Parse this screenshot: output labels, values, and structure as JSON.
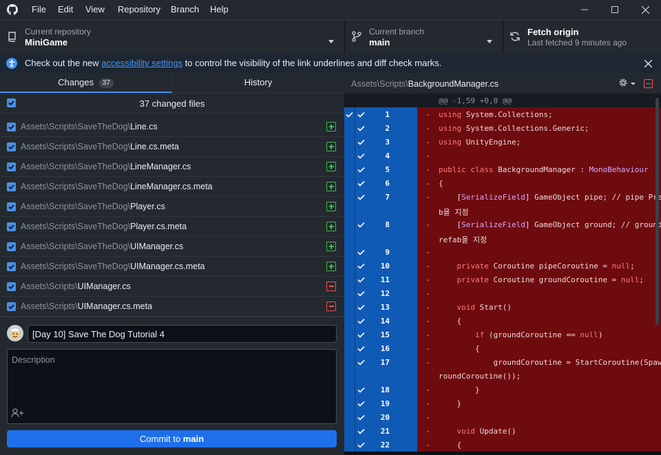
{
  "menu": [
    "File",
    "Edit",
    "View",
    "Repository",
    "Branch",
    "Help"
  ],
  "toolbar": {
    "repo_label": "Current repository",
    "repo_value": "MiniGame",
    "branch_label": "Current branch",
    "branch_value": "main",
    "fetch_label": "Fetch origin",
    "fetch_sub": "Last fetched 9 minutes ago"
  },
  "banner": {
    "before": "Check out the new ",
    "link": "accessibility settings",
    "after": " to control the visibility of the link underlines and diff check marks."
  },
  "tabs": {
    "changes": "Changes",
    "changes_count": "37",
    "history": "History"
  },
  "changed_files_label": "37 changed files",
  "files": [
    {
      "dir": "Assets\\Scripts\\SaveTheDog\\",
      "name": "Line.cs",
      "status": "added"
    },
    {
      "dir": "Assets\\Scripts\\SaveTheDog\\",
      "name": "Line.cs.meta",
      "status": "added"
    },
    {
      "dir": "Assets\\Scripts\\SaveTheDog\\",
      "name": "LineManager.cs",
      "status": "added"
    },
    {
      "dir": "Assets\\Scripts\\SaveTheDog\\",
      "name": "LineManager.cs.meta",
      "status": "added"
    },
    {
      "dir": "Assets\\Scripts\\SaveTheDog\\",
      "name": "Player.cs",
      "status": "added"
    },
    {
      "dir": "Assets\\Scripts\\SaveTheDog\\",
      "name": "Player.cs.meta",
      "status": "added"
    },
    {
      "dir": "Assets\\Scripts\\SaveTheDog\\",
      "name": "UIManager.cs",
      "status": "added"
    },
    {
      "dir": "Assets\\Scripts\\SaveTheDog\\",
      "name": "UIManager.cs.meta",
      "status": "added"
    },
    {
      "dir": "Assets\\Scripts\\",
      "name": "UIManager.cs",
      "status": "deleted"
    },
    {
      "dir": "Assets\\Scripts\\",
      "name": "UIManager.cs.meta",
      "status": "deleted"
    }
  ],
  "commit": {
    "summary": "[Day 10] Save The Dog Tutorial 4",
    "description_placeholder": "Description",
    "button_prefix": "Commit to ",
    "button_branch": "main"
  },
  "diff": {
    "path_dir": "Assets\\Scripts\\",
    "path_file": "BackgroundManager.cs",
    "hunk": "@@ -1,59 +0,0 @@",
    "colors": {
      "removed_bg": "#6e0b0f",
      "gutter_blue": "#0f5ab5",
      "keyword": "#ff7b72",
      "type": "#d2a8ff"
    },
    "lines": [
      {
        "num": "1",
        "rows": [
          "using System.Collections;"
        ]
      },
      {
        "num": "2",
        "rows": [
          "using System.Collections.Generic;"
        ]
      },
      {
        "num": "3",
        "rows": [
          "using UnityEngine;"
        ]
      },
      {
        "num": "4",
        "rows": [
          ""
        ]
      },
      {
        "num": "5",
        "rows": [
          "public class BackgroundManager : MonoBehaviour"
        ]
      },
      {
        "num": "6",
        "rows": [
          "{"
        ]
      },
      {
        "num": "7",
        "rows": [
          "    [SerializeField] GameObject pipe; // pipe Prefa",
          "b을 지정"
        ]
      },
      {
        "num": "8",
        "rows": [
          "    [SerializeField] GameObject ground; // ground P",
          "refab을 지정"
        ]
      },
      {
        "num": "9",
        "rows": [
          ""
        ]
      },
      {
        "num": "10",
        "rows": [
          "    private Coroutine pipeCoroutine = null;"
        ]
      },
      {
        "num": "11",
        "rows": [
          "    private Coroutine groundCoroutine = null;"
        ]
      },
      {
        "num": "12",
        "rows": [
          ""
        ]
      },
      {
        "num": "13",
        "rows": [
          "    void Start()"
        ]
      },
      {
        "num": "14",
        "rows": [
          "    {"
        ]
      },
      {
        "num": "15",
        "rows": [
          "        if (groundCoroutine == null)"
        ]
      },
      {
        "num": "16",
        "rows": [
          "        {"
        ]
      },
      {
        "num": "17",
        "rows": [
          "            groundCoroutine = StartCoroutine(SpawnG",
          "roundCoroutine());"
        ]
      },
      {
        "num": "18",
        "rows": [
          "        }"
        ]
      },
      {
        "num": "19",
        "rows": [
          "    }"
        ]
      },
      {
        "num": "20",
        "rows": [
          ""
        ]
      },
      {
        "num": "21",
        "rows": [
          "    void Update()"
        ]
      },
      {
        "num": "22",
        "rows": [
          "    {"
        ]
      }
    ]
  }
}
